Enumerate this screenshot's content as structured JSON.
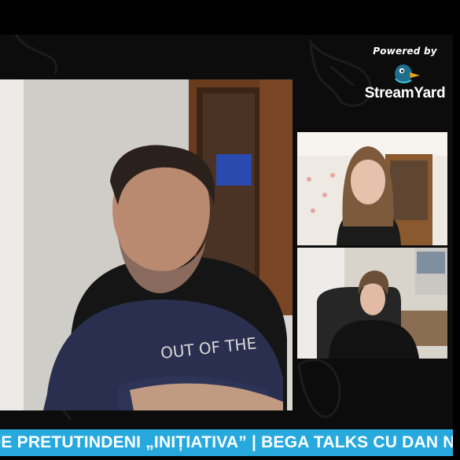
{
  "branding": {
    "powered_by": "Powered by",
    "name": "StreamYard",
    "logo_icon": "streamyard-duck-icon",
    "accent_color": "#27a9de"
  },
  "participants": [
    {
      "role": "host-camera",
      "description": "main speaker"
    },
    {
      "role": "guest-camera"
    },
    {
      "role": "guest-camera"
    }
  ],
  "ticker": {
    "text": "DE PRETUTINDENI „INIȚIATIVA” | BEGA TALKS CU DAN NE",
    "background": "#27a9de",
    "color": "#ffffff"
  }
}
